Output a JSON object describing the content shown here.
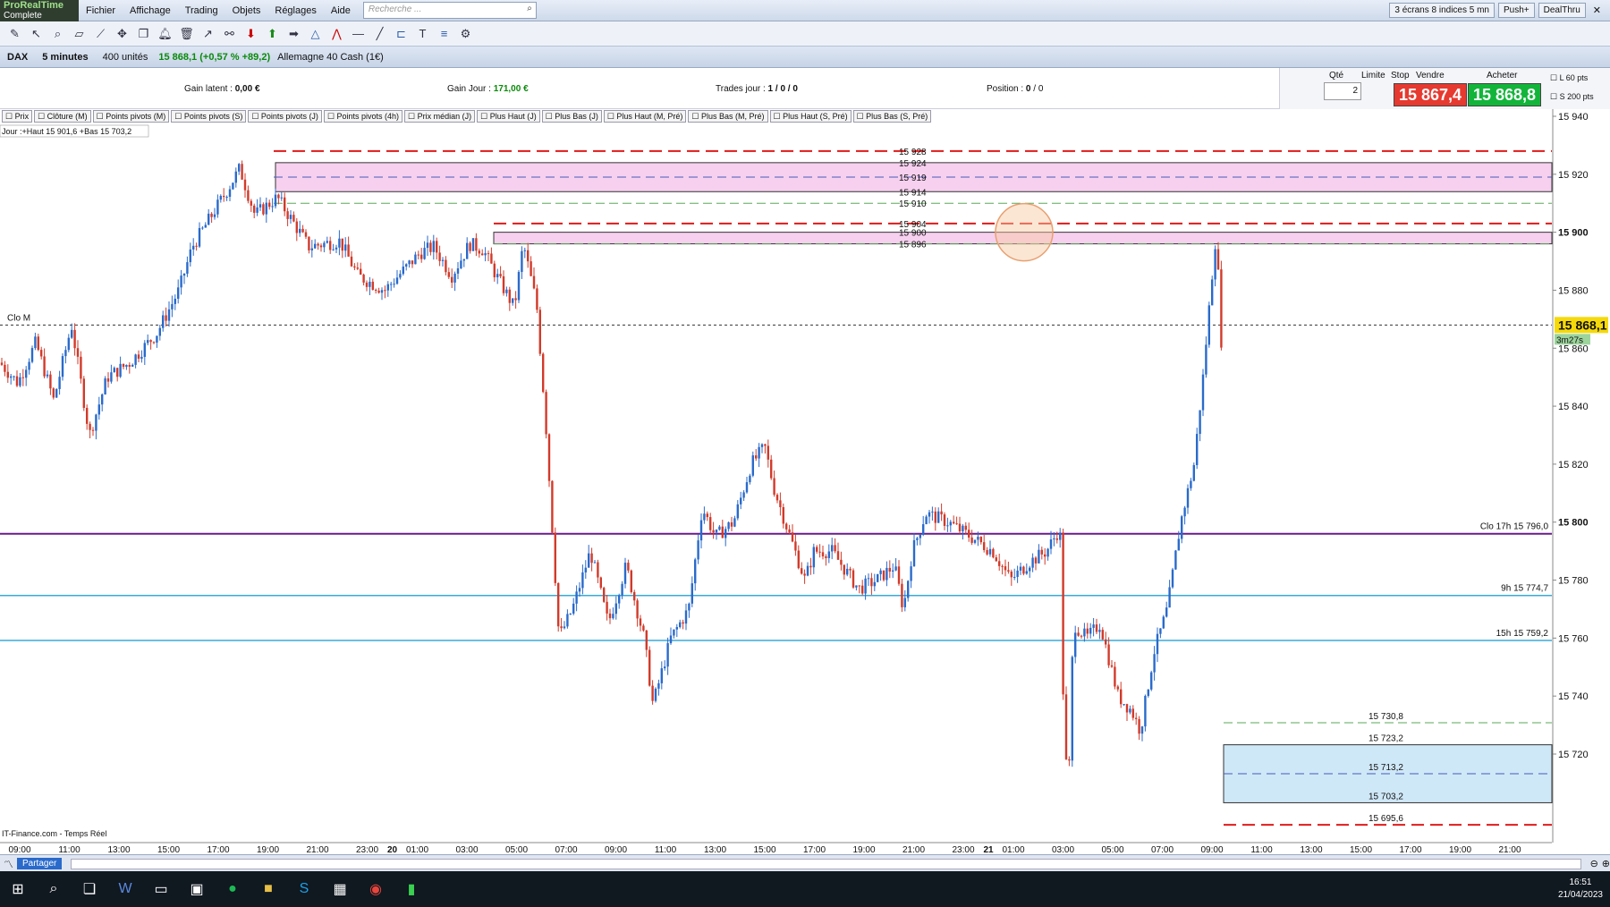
{
  "app": {
    "logo_line1": "ProRealTime",
    "logo_line2": "Complete"
  },
  "menu": [
    "Fichier",
    "Affichage",
    "Trading",
    "Objets",
    "Réglages",
    "Aide"
  ],
  "search": {
    "placeholder": "Recherche ..."
  },
  "topright": {
    "screens": "3 écrans 8 indices 5 mn",
    "push": "Push+",
    "dealthru": "DealThru"
  },
  "instrument": {
    "symbol": "DAX",
    "timeframe": "5 minutes",
    "units": "400 unités",
    "price": "15 868,1 (+0,57 % +89,2)",
    "name": "Allemagne 40 Cash (1€)"
  },
  "status": {
    "gain_latent_label": "Gain latent :",
    "gain_latent": "0,00 €",
    "gain_jour_label": "Gain Jour :",
    "gain_jour": "171,00 €",
    "trades_label": "Trades jour :",
    "trades": "1 / 0 / 0",
    "position_label": "Position :",
    "position": "0",
    "position2": "/ 0"
  },
  "trade": {
    "qte_label": "Qté",
    "qte": "2",
    "limite_label": "Limite",
    "stop_label": "Stop",
    "vendre_label": "Vendre",
    "acheter_label": "Acheter",
    "sell_price": "15 867,4",
    "buy_price": "15 868,8",
    "l_label": "L",
    "l_value": "60",
    "s_label": "S",
    "s_value": "200",
    "pts": "pts"
  },
  "indicators": [
    "Prix",
    "Clôture (M)",
    "Points pivots (M)",
    "Points pivots (S)",
    "Points pivots (J)",
    "Points pivots (4h)",
    "Prix médian (J)",
    "Plus Haut (J)",
    "Plus Bas (J)",
    "Plus Haut (M, Pré)",
    "Plus Bas (M, Pré)",
    "Plus Haut (S, Pré)",
    "Plus Bas (S, Pré)"
  ],
  "chart_info": {
    "day_label": "Jour :+Haut 15 901,6 +Bas 15 703,2",
    "source": "IT-Finance.com - Temps Réel",
    "clo_m": "Clo M",
    "current_price": "15 868,1",
    "timer": "3m27s"
  },
  "colors": {
    "up": "#2a6acb",
    "down": "#d23a2a",
    "red_dash": "#e01a1a",
    "purple": "#6a1a8a",
    "cyan": "#3aaad8",
    "pink_zone": "#f7d0ef",
    "blue_zone": "#cfe8f8",
    "green_dash": "#5aa85a"
  },
  "chart_data": {
    "type": "candlestick",
    "ylim": [
      15690,
      15945
    ],
    "y_ticks": [
      15940,
      15920,
      15900,
      15880,
      15860,
      15840,
      15820,
      15800,
      15780,
      15760,
      15740,
      15720
    ],
    "y_tick_labels": [
      "15 940",
      "15 920",
      "15 900",
      "15 880",
      "15 860",
      "15 840",
      "15 820",
      "15 800",
      "15 780",
      "15 760",
      "15 740",
      "15 720"
    ],
    "x_tick_labels": [
      "09:00",
      "11:00",
      "13:00",
      "15:00",
      "17:00",
      "19:00",
      "21:00",
      "23:00",
      "20",
      "01:00",
      "03:00",
      "05:00",
      "07:00",
      "09:00",
      "11:00",
      "13:00",
      "15:00",
      "17:00",
      "19:00",
      "21:00",
      "23:00",
      "21",
      "01:00",
      "03:00",
      "05:00",
      "07:00",
      "09:00",
      "11:00",
      "13:00",
      "15:00",
      "17:00",
      "19:00",
      "21:00"
    ],
    "path_points": [
      [
        0,
        15855
      ],
      [
        20,
        15848
      ],
      [
        40,
        15862
      ],
      [
        60,
        15842
      ],
      [
        80,
        15868
      ],
      [
        100,
        15830
      ],
      [
        120,
        15850
      ],
      [
        145,
        15855
      ],
      [
        175,
        15865
      ],
      [
        200,
        15880
      ],
      [
        215,
        15895
      ],
      [
        235,
        15905
      ],
      [
        255,
        15915
      ],
      [
        268,
        15922
      ],
      [
        285,
        15906
      ],
      [
        310,
        15912
      ],
      [
        335,
        15900
      ],
      [
        345,
        15895
      ],
      [
        380,
        15897
      ],
      [
        400,
        15885
      ],
      [
        430,
        15880
      ],
      [
        470,
        15893
      ],
      [
        485,
        15895
      ],
      [
        505,
        15885
      ],
      [
        525,
        15896
      ],
      [
        540,
        15894
      ],
      [
        555,
        15885
      ],
      [
        575,
        15874
      ],
      [
        585,
        15896
      ],
      [
        600,
        15875
      ],
      [
        610,
        15835
      ],
      [
        618,
        15795
      ],
      [
        625,
        15760
      ],
      [
        640,
        15770
      ],
      [
        660,
        15790
      ],
      [
        680,
        15765
      ],
      [
        700,
        15785
      ],
      [
        720,
        15760
      ],
      [
        730,
        15737
      ],
      [
        750,
        15760
      ],
      [
        770,
        15770
      ],
      [
        785,
        15805
      ],
      [
        800,
        15795
      ],
      [
        820,
        15800
      ],
      [
        840,
        15820
      ],
      [
        855,
        15826
      ],
      [
        865,
        15812
      ],
      [
        880,
        15798
      ],
      [
        900,
        15780
      ],
      [
        910,
        15790
      ],
      [
        930,
        15790
      ],
      [
        960,
        15777
      ],
      [
        980,
        15780
      ],
      [
        1000,
        15785
      ],
      [
        1010,
        15770
      ],
      [
        1020,
        15790
      ],
      [
        1035,
        15803
      ],
      [
        1060,
        15800
      ],
      [
        1085,
        15795
      ],
      [
        1110,
        15790
      ],
      [
        1130,
        15780
      ],
      [
        1150,
        15786
      ],
      [
        1170,
        15790
      ],
      [
        1185,
        15798
      ],
      [
        1190,
        15720
      ],
      [
        1195,
        15712
      ],
      [
        1200,
        15765
      ],
      [
        1215,
        15760
      ],
      [
        1230,
        15765
      ],
      [
        1250,
        15740
      ],
      [
        1265,
        15735
      ],
      [
        1275,
        15728
      ],
      [
        1290,
        15755
      ],
      [
        1305,
        15770
      ],
      [
        1320,
        15800
      ],
      [
        1335,
        15820
      ],
      [
        1345,
        15850
      ],
      [
        1355,
        15885
      ],
      [
        1360,
        15901
      ],
      [
        1365,
        15862
      ],
      [
        1369,
        15868
      ]
    ],
    "levels": [
      {
        "label": "15 928",
        "value": 15928,
        "style": "red-dash"
      },
      {
        "label": "15 924",
        "value": 15924,
        "style": "zone-top"
      },
      {
        "label": "15 919",
        "value": 15919,
        "style": "blue-dash"
      },
      {
        "label": "15 914",
        "value": 15914,
        "style": "zone-bottom"
      },
      {
        "label": "15 910",
        "value": 15910,
        "style": "green-dash"
      },
      {
        "label": "15 904",
        "value": 15903,
        "style": "red-dash"
      },
      {
        "label": "15 900",
        "value": 15900,
        "style": "zone-top"
      },
      {
        "label": "15 896",
        "value": 15896,
        "style": "green-dash"
      },
      {
        "label": "Clo 17h 15 796,0",
        "value": 15796,
        "style": "purple"
      },
      {
        "label": "9h 15 774,7",
        "value": 15774.7,
        "style": "cyan"
      },
      {
        "label": "15h 15 759,2",
        "value": 15759.2,
        "style": "cyan"
      },
      {
        "label": "15 730,8",
        "value": 15730.8,
        "style": "green-dash"
      },
      {
        "label": "15 723,2",
        "value": 15723.2,
        "style": "zone-top"
      },
      {
        "label": "15 713,2",
        "value": 15713.2,
        "style": "blue-dash"
      },
      {
        "label": "15 703,2",
        "value": 15703.2,
        "style": "zone-bottom"
      },
      {
        "label": "15 695,6",
        "value": 15695.6,
        "style": "red-dash"
      }
    ],
    "clo_m_value": 15868
  },
  "taskbar": {
    "time": "16:51",
    "date": "21/04/2023"
  },
  "bottom": {
    "share": "Partager"
  }
}
